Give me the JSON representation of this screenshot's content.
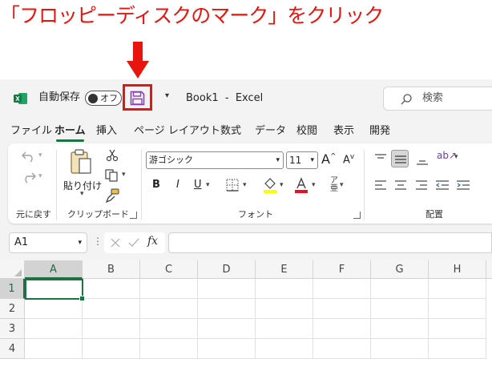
{
  "instruction": "「フロッピーディスクのマーク」をクリック",
  "colors": {
    "accent": "#e8140e",
    "excel_green": "#1e7145",
    "save_icon": "#8b3dbd"
  },
  "titlebar": {
    "app_icon": "excel-logo-icon",
    "autosave_label": "自動保存",
    "autosave_state": "オフ",
    "save_icon": "floppy-disk-icon",
    "qat_dropdown_icon": "chevron-down-icon",
    "doc_title": "Book1  -  Excel",
    "search_placeholder": "検索"
  },
  "tabs": [
    "ファイル",
    "ホーム",
    "挿入",
    "ページ レイアウト",
    "数式",
    "データ",
    "校閲",
    "表示",
    "開発"
  ],
  "active_tab": "ホーム",
  "ribbon": {
    "undo_group_label": "元に戻す",
    "clipboard": {
      "paste_label": "貼り付け",
      "group_label": "クリップボード"
    },
    "font": {
      "font_name": "游ゴシック",
      "font_size": "11",
      "group_label": "フォント",
      "bold": "B",
      "italic": "I",
      "underline": "U"
    },
    "alignment": {
      "group_label": "配置"
    }
  },
  "formula_bar": {
    "name_box": "A1",
    "fx_label": "fx",
    "formula": ""
  },
  "grid": {
    "columns": [
      "A",
      "B",
      "C",
      "D",
      "E",
      "F",
      "G",
      "H"
    ],
    "rows": [
      "1",
      "2",
      "3",
      "4"
    ],
    "selected_cell": "A1"
  }
}
